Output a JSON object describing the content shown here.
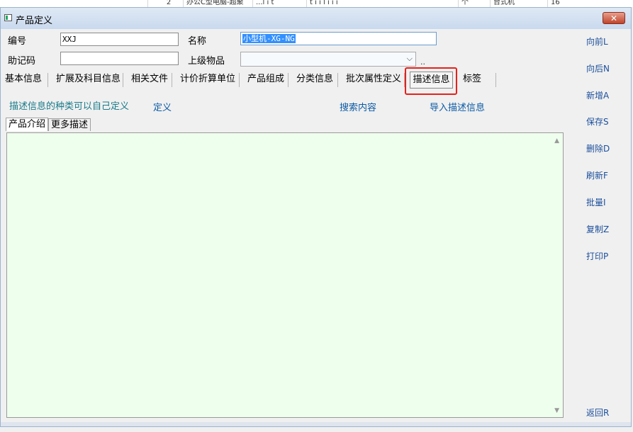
{
  "background_row": [
    "2",
    "办公C型电脑-超聚",
    "...l i t",
    "t i i l i i i",
    "个",
    "台式机",
    "16"
  ],
  "window": {
    "title": "产品定义",
    "close_glyph": "✕"
  },
  "fields": {
    "code_label": "编号",
    "code_value": "XXJ",
    "name_label": "名称",
    "name_value": "小型机-XG-NG",
    "mnemonic_label": "助记码",
    "mnemonic_value": "",
    "parent_label": "上级物品",
    "parent_value": "",
    "parent_more": "..",
    "combo_arrow": "⌵"
  },
  "tabs": [
    "基本信息",
    "扩展及科目信息",
    "相关文件",
    "计价折算单位",
    "产品组成",
    "分类信息",
    "批次属性定义",
    "描述信息",
    "标签"
  ],
  "active_tab": "描述信息",
  "description": {
    "hint": "描述信息的种类可以自己定义",
    "define_link": "定义",
    "search_link": "搜索内容",
    "import_link": "导入描述信息",
    "subtabs": [
      "产品介绍",
      "更多描述"
    ],
    "content": ""
  },
  "side_buttons": [
    "向前L",
    "向后N",
    "新增A",
    "保存S",
    "删除D",
    "刷新F",
    "批量I",
    "复制Z",
    "打印P"
  ],
  "return_button": "返回R",
  "colors": {
    "text_area_bg": "#efffee",
    "highlight": "#e8201a",
    "link": "#0a5aa6"
  }
}
